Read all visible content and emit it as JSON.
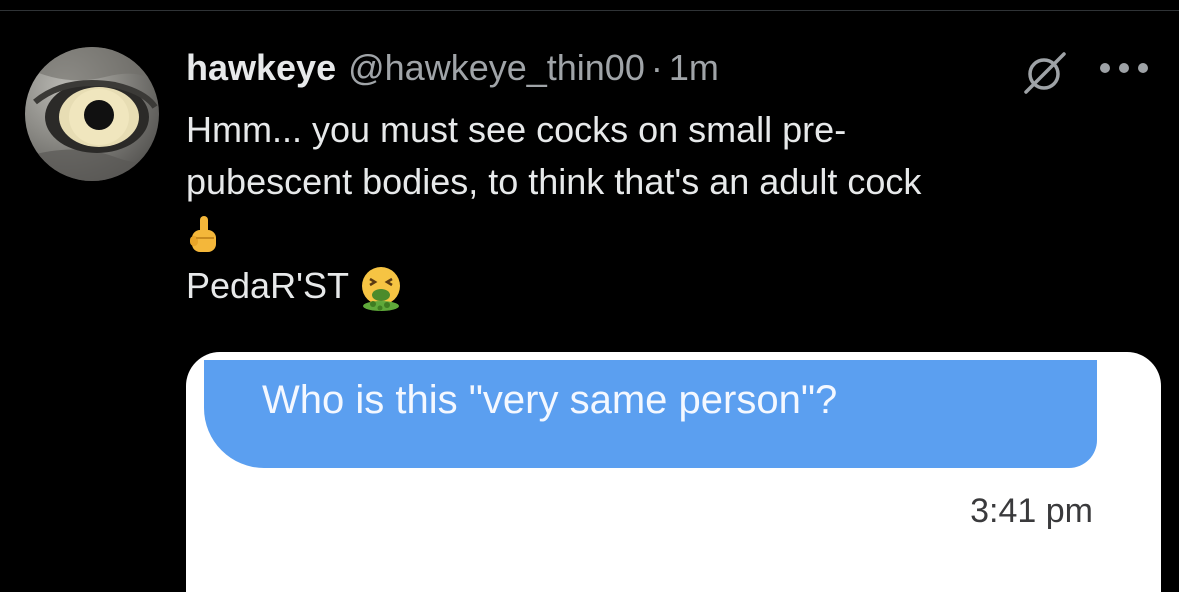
{
  "tweet": {
    "display_name": "hawkeye",
    "handle": "@hawkeye_thin00",
    "separator": "·",
    "time": "1m",
    "text_lines": [
      "Hmm... you must see cocks on small pre-",
      "pubescent bodies, to think that's an adult cock"
    ],
    "text_line_4": "PedaR'ST"
  },
  "icons": {
    "avatar": "eye-avatar",
    "grok": "grok-icon",
    "more": "more-icon",
    "emoji_1": "middle-finger-emoji",
    "emoji_2": "vomiting-face-emoji"
  },
  "embed": {
    "message": "Who is this \"very same person\"?",
    "message_time": "3:41 pm",
    "bubble_color": "#5b9ff0"
  },
  "colors": {
    "background": "#000000",
    "text": "#e7e9ea",
    "muted": "#a0a4a8"
  }
}
